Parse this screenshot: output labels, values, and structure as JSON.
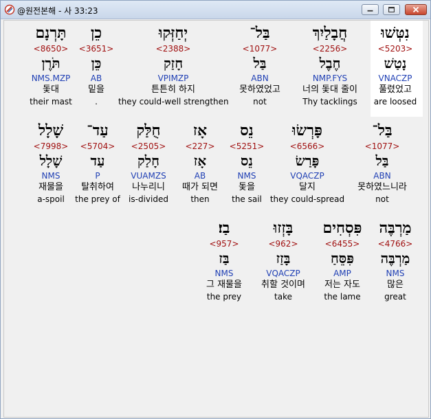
{
  "window": {
    "title": "@원전본해 - 사 33:23"
  },
  "colors": {
    "strong": "#a01010",
    "grammar": "#1f3fb4"
  },
  "icons": {
    "app": "bible-app-icon",
    "minimize": "minimize-icon",
    "maximize": "maximize-icon",
    "close": "close-icon"
  },
  "verse": {
    "rows": [
      {
        "words": [
          {
            "heb": "נִטְּשׁוּ",
            "strong": "<5203>",
            "root": "נָטַשׁ",
            "gram": "VNACZP",
            "kor": "풀렸었고",
            "eng": "are loosed",
            "selected": true
          },
          {
            "heb": "חֲבָלַיִךְ",
            "strong": "<2256>",
            "root": "חֶבֶל",
            "gram": "NMP.FYS",
            "kor": "너의 돛대 줄이",
            "eng": "Thy tacklings"
          },
          {
            "heb": "בַּל־",
            "strong": "<1077>",
            "root": "בַּל",
            "gram": "ABN",
            "kor": "못하였었고",
            "eng": "not"
          },
          {
            "heb": "יְחַזְּקוּ",
            "strong": "<2388>",
            "root": "חָזַק",
            "gram": "VPIMZP",
            "kor": "튼튼히 하지",
            "eng": "they could-well strengthen"
          },
          {
            "heb": "כֵן",
            "strong": "<3651>",
            "root": "כֵּן",
            "gram": "AB",
            "kor": "밑을",
            "eng": "."
          },
          {
            "heb": "תָּרְנָם",
            "strong": "<8650>",
            "root": "תֹּרֶן",
            "gram": "NMS.MZP",
            "kor": "돛대",
            "eng": "their mast"
          }
        ]
      },
      {
        "words": [
          {
            "heb": "בַּל־",
            "strong": "<1077>",
            "root": "בַּל",
            "gram": "ABN",
            "kor": "못하였느니라",
            "eng": "not"
          },
          {
            "heb": "פָּרְשׂוּ",
            "strong": "<6566>",
            "root": "פָּרַשׂ",
            "gram": "VQACZP",
            "kor": "달지",
            "eng": "they could-spread"
          },
          {
            "heb": "נֵס",
            "strong": "<5251>",
            "root": "נֵס",
            "gram": "NMS",
            "kor": "돛을",
            "eng": "the sail"
          },
          {
            "heb": "אָז",
            "strong": "<227>",
            "root": "אָז",
            "gram": "AB",
            "kor": "때가 되면",
            "eng": "then"
          },
          {
            "heb": "חֻלַּק",
            "strong": "<2505>",
            "root": "חָלַק",
            "gram": "VUAMZS",
            "kor": "나누리니",
            "eng": "is-divided"
          },
          {
            "heb": "עַד־",
            "strong": "<5704>",
            "root": "עַד",
            "gram": "P",
            "kor": "탈취하여",
            "eng": "the prey of"
          },
          {
            "heb": "שָׁלָל",
            "strong": "<7998>",
            "root": "שָׁלָל",
            "gram": "NMS",
            "kor": "재물을",
            "eng": "a-spoil"
          }
        ]
      },
      {
        "words": [
          {
            "heb": "מַרְבֶּה",
            "strong": "<4766>",
            "root": "מַרְבֶּה",
            "gram": "NMS",
            "kor": "많은",
            "eng": "great"
          },
          {
            "heb": "פִּסְחִים",
            "strong": "<6455>",
            "root": "פִּסֵּחַ",
            "gram": "AMP",
            "kor": "저는 자도",
            "eng": "the lame"
          },
          {
            "heb": "בָּזְזוּ",
            "strong": "<962>",
            "root": "בָּזַז",
            "gram": "VQACZP",
            "kor": "취할 것이며",
            "eng": "take"
          },
          {
            "heb": "בַז׃",
            "strong": "<957>",
            "root": "בַּז",
            "gram": "NMS",
            "kor": "그 재물을",
            "eng": "the prey"
          }
        ]
      }
    ]
  }
}
